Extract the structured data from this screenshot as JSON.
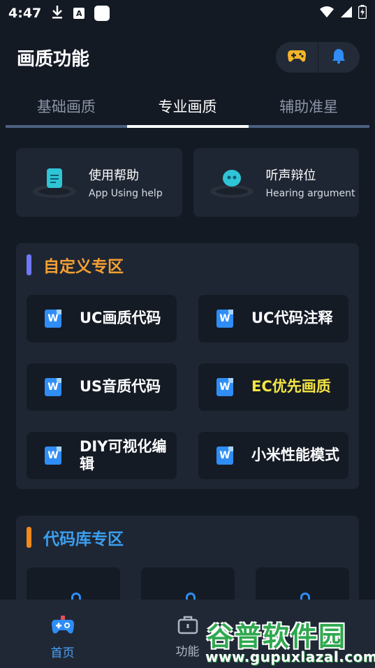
{
  "status_bar": {
    "time": "4:47",
    "download_icon": "download-icon",
    "a_icon": "A"
  },
  "header": {
    "title": "画质功能",
    "actions": [
      "gamepad-icon",
      "bell-icon"
    ]
  },
  "tabs": [
    {
      "label": "基础画质",
      "active": false
    },
    {
      "label": "专业画质",
      "active": true
    },
    {
      "label": "辅助准星",
      "active": false
    }
  ],
  "help_cards": [
    {
      "title": "使用帮助",
      "subtitle": "App Using help",
      "icon": "document-icon"
    },
    {
      "title": "听声辩位",
      "subtitle": "Hearing argument",
      "icon": "robot-icon"
    }
  ],
  "sections": {
    "custom": {
      "title": "自定义专区",
      "title_color": "#f5a033",
      "bar_color": "#6f78f7",
      "items": [
        {
          "label": "UC画质代码",
          "color": "#ffffff"
        },
        {
          "label": "UC代码注释",
          "color": "#ffffff"
        },
        {
          "label": "US音质代码",
          "color": "#ffffff"
        },
        {
          "label": "EC优先画质",
          "color": "#f5e642"
        },
        {
          "label": "DIY可视化编辑",
          "color": "#ffffff"
        },
        {
          "label": "小米性能模式",
          "color": "#ffffff"
        }
      ]
    },
    "library": {
      "title": "代码库专区",
      "title_color": "#3aa0f0",
      "bar_color": "#f08a1a"
    }
  },
  "bottom_nav": [
    {
      "label": "首页",
      "icon": "gamepad-home-icon",
      "active": true
    },
    {
      "label": "功能",
      "icon": "briefcase-icon",
      "active": false
    }
  ],
  "watermark": {
    "main": "谷普软件园",
    "url": "www.gupuxlazal.com"
  },
  "colors": {
    "background": "#141a24",
    "card": "#1f2633",
    "accent": "#2f8df5"
  }
}
